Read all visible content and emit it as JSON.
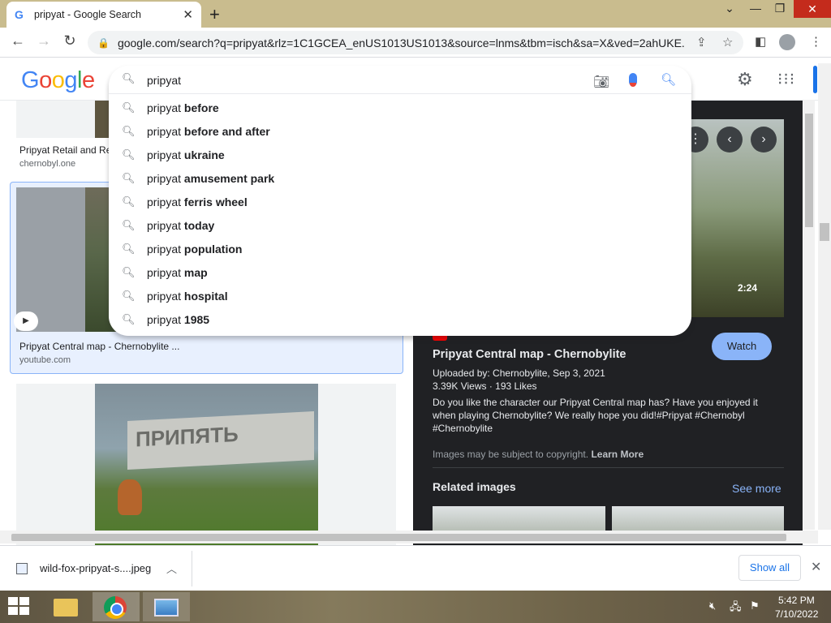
{
  "browser": {
    "tab_title": "pripyat - Google Search",
    "tab_close": "✕",
    "new_tab": "+",
    "url": "google.com/search?q=pripyat&rlz=1C1GCEA_enUS1013US1013&source=lnms&tbm=isch&sa=X&ved=2ahUKE..."
  },
  "google": {
    "logo_letters": [
      "G",
      "o",
      "o",
      "g",
      "l",
      "e"
    ],
    "logo_colors": [
      "#4285f4",
      "#ea4335",
      "#fbbc05",
      "#4285f4",
      "#34a853",
      "#ea4335"
    ]
  },
  "search": {
    "query": "pripyat",
    "suggestions": [
      {
        "prefix": "pripyat ",
        "bold": "before"
      },
      {
        "prefix": "pripyat ",
        "bold": "before and after"
      },
      {
        "prefix": "pripyat ",
        "bold": "ukraine"
      },
      {
        "prefix": "pripyat ",
        "bold": "amusement park"
      },
      {
        "prefix": "pripyat ",
        "bold": "ferris wheel"
      },
      {
        "prefix": "pripyat ",
        "bold": "today"
      },
      {
        "prefix": "pripyat ",
        "bold": "population"
      },
      {
        "prefix": "pripyat ",
        "bold": "map"
      },
      {
        "prefix": "pripyat ",
        "bold": "hospital"
      },
      {
        "prefix": "pripyat ",
        "bold": "1985"
      }
    ]
  },
  "results": [
    {
      "title": "Pripyat Retail and Re",
      "source": "chernobyl.one"
    },
    {
      "title": "Pripyat Central map - Chernobylite ...",
      "source": "youtube.com"
    }
  ],
  "panel": {
    "duration": "2:24",
    "site": "YouTube",
    "title": "Pripyat Central map - Chernobylite",
    "watch": "Watch",
    "uploaded": "Uploaded by: Chernobylite, Sep 3, 2021",
    "stats": "3.39K Views  ·  193 Likes",
    "description": "Do you like the character our Pripyat Central map has? Have you enjoyed it when playing Chernobylite? We really hope you did!#Pripyat #Chernobyl #Chernobylite",
    "copyright": "Images may be subject to copyright.",
    "learn_more": "Learn More",
    "related": "Related images",
    "see_more": "See more"
  },
  "downloads": {
    "file": "wild-fox-pripyat-s....jpeg",
    "show_all": "Show all"
  },
  "taskbar": {
    "time": "5:42 PM",
    "date": "7/10/2022"
  }
}
